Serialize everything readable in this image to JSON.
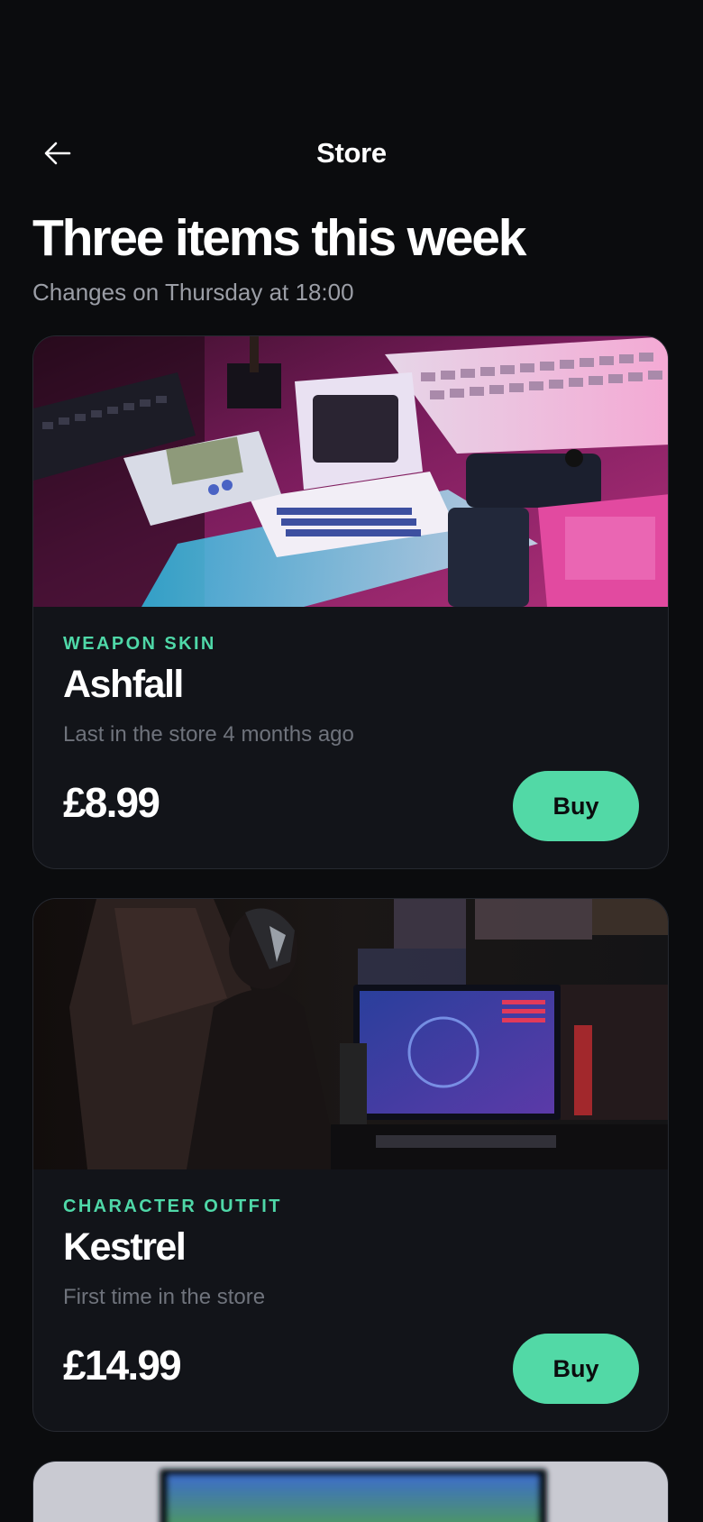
{
  "header": {
    "title": "Store",
    "back_icon": "arrow-left-icon"
  },
  "headline": "Three items this week",
  "subhead": "Changes on Thursday at 18:00",
  "colors": {
    "background": "#0b0c0e",
    "card": "#121419",
    "accent": "#52d9a6",
    "category_text": "#4fd8a8",
    "muted_text": "#9b9ea6"
  },
  "items": [
    {
      "category": "WEAPON SKIN",
      "name": "Ashfall",
      "note": "Last in the store 4 months ago",
      "price": "£8.99",
      "buy_label": "Buy"
    },
    {
      "category": "CHARACTER OUTFIT",
      "name": "Kestrel",
      "note": "First time in the store",
      "price": "£14.99",
      "buy_label": "Buy"
    }
  ]
}
